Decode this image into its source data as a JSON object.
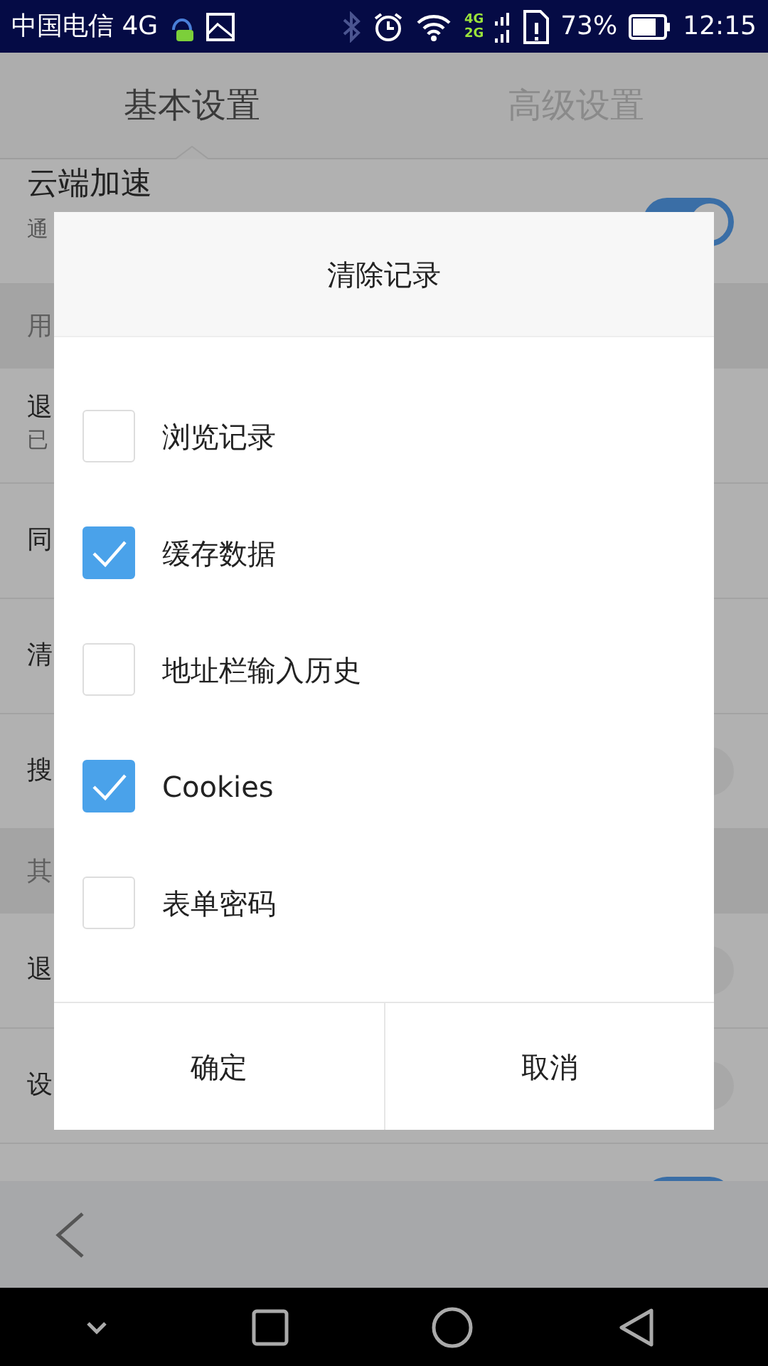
{
  "status_bar": {
    "carrier": "中国电信 4G",
    "signal_labels": [
      "4G",
      "2G"
    ],
    "battery": "73%",
    "time": "12:15"
  },
  "tabs": [
    {
      "label": "基本设置",
      "selected": true
    },
    {
      "label": "高级设置",
      "selected": false
    }
  ],
  "settings_rows": [
    {
      "kind": "row",
      "title": "云端加速",
      "subtitle": "通",
      "on": true
    },
    {
      "kind": "header",
      "title": "用"
    },
    {
      "kind": "row",
      "title": "退",
      "subtitle": "已"
    },
    {
      "kind": "row",
      "title": "同"
    },
    {
      "kind": "row",
      "title": "清"
    },
    {
      "kind": "row",
      "title": "搜",
      "on": false
    },
    {
      "kind": "header",
      "title": "其"
    },
    {
      "kind": "row",
      "title": "退",
      "on": false
    },
    {
      "kind": "row",
      "title": "设",
      "on": false
    },
    {
      "kind": "row",
      "on": true
    }
  ],
  "dialog": {
    "title": "清除记录",
    "options": [
      {
        "label": "浏览记录",
        "checked": false
      },
      {
        "label": "缓存数据",
        "checked": true
      },
      {
        "label": "地址栏输入历史",
        "checked": false
      },
      {
        "label": "Cookies",
        "checked": true
      },
      {
        "label": "表单密码",
        "checked": false
      }
    ],
    "buttons": [
      "确定",
      "取消"
    ]
  }
}
